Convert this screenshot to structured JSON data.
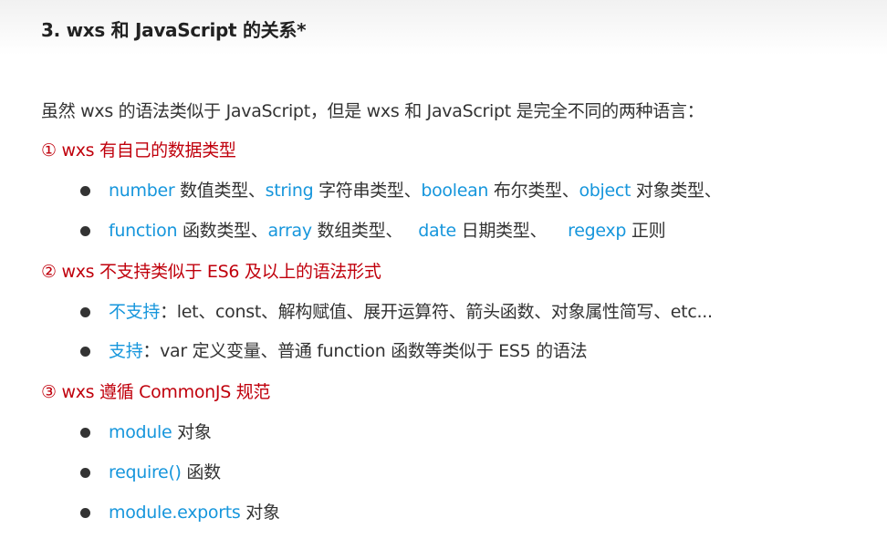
{
  "title": "3. wxs 和 JavaScript 的关系*",
  "colors": {
    "red": "#c0000c",
    "blue": "#1696dc",
    "text": "#333333"
  },
  "lines": [
    {
      "kind": "para",
      "segments": [
        {
          "t": "虽然 wxs 的语法类似于 JavaScript，但是 wxs 和 JavaScript 是完全不同的两种语言：",
          "c": "plain"
        }
      ]
    },
    {
      "kind": "heading",
      "segments": [
        {
          "t": "① wxs 有自己的数据类型",
          "c": "red"
        }
      ]
    },
    {
      "kind": "bullet",
      "segments": [
        {
          "t": "number",
          "c": "blue"
        },
        {
          "t": " 数值类型、",
          "c": "plain"
        },
        {
          "t": "string",
          "c": "blue"
        },
        {
          "t": " 字符串类型、",
          "c": "plain"
        },
        {
          "t": "boolean",
          "c": "blue"
        },
        {
          "t": " 布尔类型、",
          "c": "plain"
        },
        {
          "t": "object",
          "c": "blue"
        },
        {
          "t": " 对象类型、",
          "c": "plain"
        }
      ]
    },
    {
      "kind": "bullet",
      "segments": [
        {
          "t": "function",
          "c": "blue"
        },
        {
          "t": " 函数类型、",
          "c": "plain"
        },
        {
          "t": "array",
          "c": "blue"
        },
        {
          "t": " 数组类型、   ",
          "c": "plain"
        },
        {
          "t": "date",
          "c": "blue"
        },
        {
          "t": " 日期类型、    ",
          "c": "plain"
        },
        {
          "t": "regexp",
          "c": "blue"
        },
        {
          "t": " 正则",
          "c": "plain"
        }
      ]
    },
    {
      "kind": "heading",
      "segments": [
        {
          "t": "② wxs 不支持类似于 ES6 及以上的语法形式",
          "c": "red"
        }
      ]
    },
    {
      "kind": "bullet",
      "segments": [
        {
          "t": "不支持",
          "c": "blue"
        },
        {
          "t": "：let、const、解构赋值、展开运算符、箭头函数、对象属性简写、etc...",
          "c": "plain"
        }
      ]
    },
    {
      "kind": "bullet",
      "segments": [
        {
          "t": "支持",
          "c": "blue"
        },
        {
          "t": "：var 定义变量、普通 function 函数等类似于 ES5 的语法",
          "c": "plain"
        }
      ]
    },
    {
      "kind": "heading",
      "segments": [
        {
          "t": "③ wxs 遵循 CommonJS 规范",
          "c": "red"
        }
      ]
    },
    {
      "kind": "bullet",
      "segments": [
        {
          "t": "module",
          "c": "blue"
        },
        {
          "t": " 对象",
          "c": "plain"
        }
      ]
    },
    {
      "kind": "bullet",
      "segments": [
        {
          "t": "require()",
          "c": "blue"
        },
        {
          "t": " 函数",
          "c": "plain"
        }
      ]
    },
    {
      "kind": "bullet",
      "segments": [
        {
          "t": "module.exports",
          "c": "blue"
        },
        {
          "t": " 对象",
          "c": "plain"
        }
      ]
    }
  ]
}
